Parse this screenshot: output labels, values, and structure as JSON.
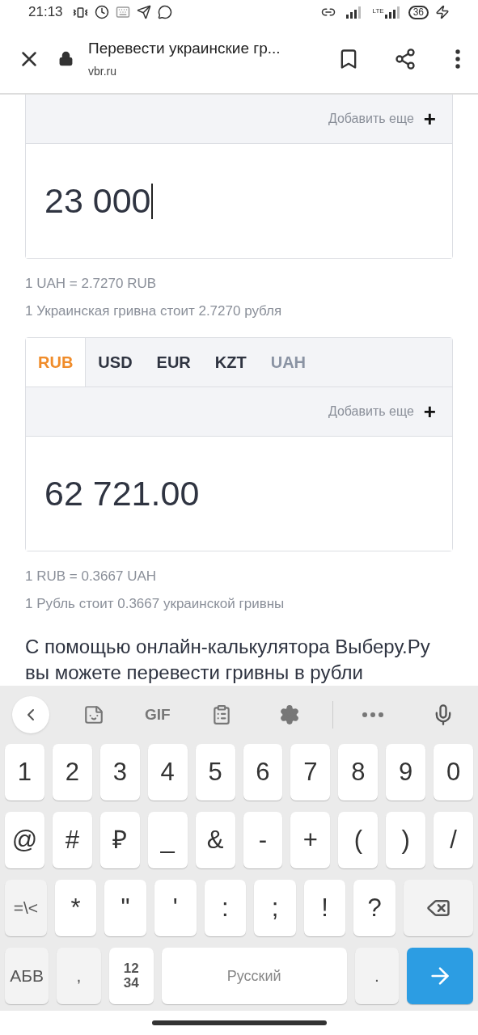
{
  "status_bar": {
    "time": "21:13",
    "network": "LTE",
    "battery": "36"
  },
  "browser_bar": {
    "title": "Перевести украинские гр...",
    "url": "vbr.ru"
  },
  "source": {
    "add_more": "Добавить еще",
    "add_symbol": "+",
    "value": "23 000",
    "rate": "1 UAH = 2.7270 RUB",
    "rate_text": "1 Украинская гривна стоит 2.7270 рубля"
  },
  "target": {
    "tabs": [
      {
        "label": "RUB",
        "selected": true,
        "disabled": false
      },
      {
        "label": "USD",
        "selected": false,
        "disabled": false
      },
      {
        "label": "EUR",
        "selected": false,
        "disabled": false
      },
      {
        "label": "KZT",
        "selected": false,
        "disabled": false
      },
      {
        "label": "UAH",
        "selected": false,
        "disabled": true
      }
    ],
    "add_more": "Добавить еще",
    "add_symbol": "+",
    "value": "62 721.00",
    "rate": "1 RUB = 0.3667 UAH",
    "rate_text": "1 Рубль стоит 0.3667 украинской гривны"
  },
  "paragraph": "С помощью онлайн-калькулятора Выберу.Ру вы можете перевести гривны в рубли",
  "keyboard": {
    "toolbar_gif": "GIF",
    "key_rows": [
      {
        "keys": [
          {
            "label": "1",
            "kind": "light"
          },
          {
            "label": "2",
            "kind": "light"
          },
          {
            "label": "3",
            "kind": "light"
          },
          {
            "label": "4",
            "kind": "light"
          },
          {
            "label": "5",
            "kind": "light"
          },
          {
            "label": "6",
            "kind": "light"
          },
          {
            "label": "7",
            "kind": "light"
          },
          {
            "label": "8",
            "kind": "light"
          },
          {
            "label": "9",
            "kind": "light"
          },
          {
            "label": "0",
            "kind": "light"
          }
        ]
      },
      {
        "keys": [
          {
            "label": "@",
            "kind": "light"
          },
          {
            "label": "#",
            "kind": "light"
          },
          {
            "label": "₽",
            "kind": "light"
          },
          {
            "label": "_",
            "kind": "light"
          },
          {
            "label": "&",
            "kind": "light"
          },
          {
            "label": "-",
            "kind": "light"
          },
          {
            "label": "+",
            "kind": "light"
          },
          {
            "label": "(",
            "kind": "light"
          },
          {
            "label": ")",
            "kind": "light"
          },
          {
            "label": "/",
            "kind": "light"
          }
        ]
      },
      {
        "keys": [
          {
            "label": "=\\<",
            "kind": "dark"
          },
          {
            "label": "*",
            "kind": "light"
          },
          {
            "label": "\"",
            "kind": "light"
          },
          {
            "label": "'",
            "kind": "light"
          },
          {
            "label": ":",
            "kind": "light"
          },
          {
            "label": ";",
            "kind": "light"
          },
          {
            "label": "!",
            "kind": "light"
          },
          {
            "label": "?",
            "kind": "light"
          },
          {
            "kind": "backspace"
          }
        ]
      },
      {
        "keys": [
          {
            "label": "АБВ",
            "kind": "dark"
          },
          {
            "label": ",",
            "kind": "dark"
          },
          {
            "label": "12 34",
            "kind": "numpad"
          },
          {
            "label": "Русский",
            "kind": "space"
          },
          {
            "label": ".",
            "kind": "dark"
          },
          {
            "kind": "enter"
          }
        ]
      }
    ]
  }
}
